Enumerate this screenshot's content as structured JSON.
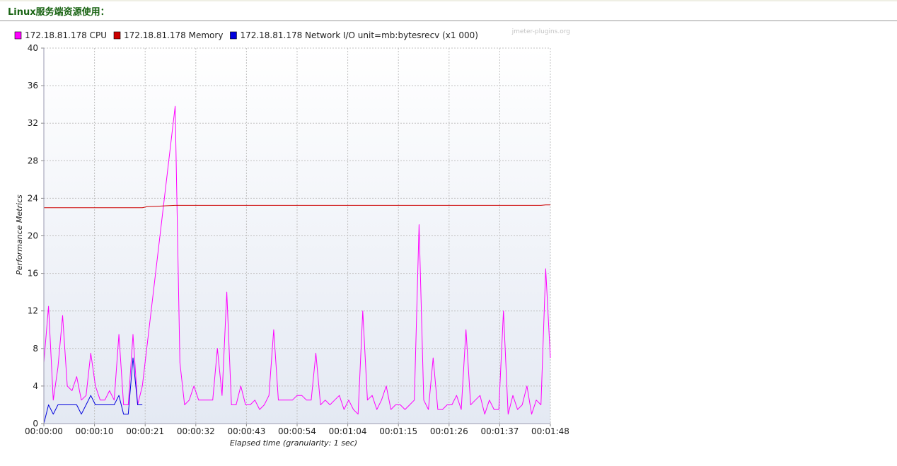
{
  "header": {
    "title": "Linux服务端资源使用："
  },
  "chart_data": {
    "type": "line",
    "watermark": "jmeter-plugins.org",
    "xlabel": "Elapsed time (granularity: 1 sec)",
    "ylabel": "Performance Metrics",
    "ylim": [
      0,
      40
    ],
    "xlim": [
      0,
      108
    ],
    "y_ticks": [
      "0",
      "4",
      "8",
      "12",
      "16",
      "20",
      "24",
      "28",
      "32",
      "36",
      "40"
    ],
    "x_ticks": [
      {
        "t": 0,
        "label": "00:00:00"
      },
      {
        "t": 10.8,
        "label": "00:00:10"
      },
      {
        "t": 21.6,
        "label": "00:00:21"
      },
      {
        "t": 32.4,
        "label": "00:00:32"
      },
      {
        "t": 43.2,
        "label": "00:00:43"
      },
      {
        "t": 54,
        "label": "00:00:54"
      },
      {
        "t": 64.8,
        "label": "00:01:04"
      },
      {
        "t": 75.6,
        "label": "00:01:15"
      },
      {
        "t": 86.4,
        "label": "00:01:26"
      },
      {
        "t": 97.2,
        "label": "00:01:37"
      },
      {
        "t": 108,
        "label": "00:01:48"
      }
    ],
    "grid": true,
    "legend_position": "top",
    "series": [
      {
        "name": "172.18.81.178 CPU",
        "color": "#ff00ff",
        "points": [
          [
            0,
            6.5
          ],
          [
            1,
            12.5
          ],
          [
            2,
            2.5
          ],
          [
            3,
            6
          ],
          [
            4,
            11.5
          ],
          [
            5,
            4
          ],
          [
            6,
            3.5
          ],
          [
            7,
            5
          ],
          [
            8,
            2.5
          ],
          [
            9,
            3
          ],
          [
            10,
            7.5
          ],
          [
            11,
            4
          ],
          [
            12,
            2.5
          ],
          [
            13,
            2.5
          ],
          [
            14,
            3.5
          ],
          [
            15,
            2.5
          ],
          [
            16,
            9.5
          ],
          [
            17,
            2
          ],
          [
            18,
            2
          ],
          [
            19,
            9.5
          ],
          [
            20,
            2
          ],
          [
            21,
            4
          ],
          [
            28,
            33.8
          ],
          [
            29,
            6.5
          ],
          [
            30,
            2
          ],
          [
            31,
            2.5
          ],
          [
            32,
            4
          ],
          [
            33,
            2.5
          ],
          [
            34,
            2.5
          ],
          [
            35,
            2.5
          ],
          [
            36,
            2.5
          ],
          [
            37,
            8
          ],
          [
            38,
            3
          ],
          [
            39,
            14
          ],
          [
            40,
            2
          ],
          [
            41,
            2
          ],
          [
            42,
            4
          ],
          [
            43,
            2
          ],
          [
            44,
            2
          ],
          [
            45,
            2.5
          ],
          [
            46,
            1.5
          ],
          [
            47,
            2
          ],
          [
            48,
            3
          ],
          [
            49,
            10
          ],
          [
            50,
            2.5
          ],
          [
            51,
            2.5
          ],
          [
            52,
            2.5
          ],
          [
            53,
            2.5
          ],
          [
            54,
            3
          ],
          [
            55,
            3
          ],
          [
            56,
            2.5
          ],
          [
            57,
            2.5
          ],
          [
            58,
            7.5
          ],
          [
            59,
            2
          ],
          [
            60,
            2.5
          ],
          [
            61,
            2
          ],
          [
            62,
            2.5
          ],
          [
            63,
            3
          ],
          [
            64,
            1.5
          ],
          [
            65,
            2.5
          ],
          [
            66,
            1.5
          ],
          [
            67,
            1
          ],
          [
            68,
            12
          ],
          [
            69,
            2.5
          ],
          [
            70,
            3
          ],
          [
            71,
            1.5
          ],
          [
            72,
            2.5
          ],
          [
            73,
            4
          ],
          [
            74,
            1.5
          ],
          [
            75,
            2
          ],
          [
            76,
            2
          ],
          [
            77,
            1.5
          ],
          [
            78,
            2
          ],
          [
            79,
            2.5
          ],
          [
            80,
            21.2
          ],
          [
            81,
            2.5
          ],
          [
            82,
            1.5
          ],
          [
            83,
            7
          ],
          [
            84,
            1.5
          ],
          [
            85,
            1.5
          ],
          [
            86,
            2
          ],
          [
            87,
            2
          ],
          [
            88,
            3
          ],
          [
            89,
            1.5
          ],
          [
            90,
            10
          ],
          [
            91,
            2
          ],
          [
            92,
            2.5
          ],
          [
            93,
            3
          ],
          [
            94,
            1
          ],
          [
            95,
            2.5
          ],
          [
            96,
            1.5
          ],
          [
            97,
            1.5
          ],
          [
            98,
            12
          ],
          [
            99,
            1
          ],
          [
            100,
            3
          ],
          [
            101,
            1.5
          ],
          [
            102,
            2
          ],
          [
            103,
            4
          ],
          [
            104,
            1
          ],
          [
            105,
            2.5
          ],
          [
            106,
            2
          ],
          [
            107,
            16.5
          ],
          [
            108,
            7
          ]
        ]
      },
      {
        "name": "172.18.81.178 Memory",
        "color": "#cc0000",
        "points": [
          [
            0,
            23
          ],
          [
            10,
            23
          ],
          [
            20,
            23
          ],
          [
            21,
            23
          ],
          [
            22,
            23.1
          ],
          [
            24,
            23.15
          ],
          [
            26,
            23.2
          ],
          [
            28,
            23.25
          ],
          [
            40,
            23.25
          ],
          [
            60,
            23.25
          ],
          [
            80,
            23.25
          ],
          [
            100,
            23.25
          ],
          [
            106,
            23.25
          ],
          [
            107,
            23.3
          ],
          [
            108,
            23.3
          ]
        ]
      },
      {
        "name": "172.18.81.178 Network I/O unit=mb:bytesrecv (x1 000)",
        "color": "#0000dd",
        "points": [
          [
            0,
            0
          ],
          [
            1,
            2
          ],
          [
            2,
            1
          ],
          [
            3,
            2
          ],
          [
            4,
            2
          ],
          [
            5,
            2
          ],
          [
            6,
            2
          ],
          [
            7,
            2
          ],
          [
            8,
            1
          ],
          [
            9,
            2
          ],
          [
            10,
            3
          ],
          [
            11,
            2
          ],
          [
            12,
            2
          ],
          [
            13,
            2
          ],
          [
            14,
            2
          ],
          [
            15,
            2
          ],
          [
            16,
            3
          ],
          [
            17,
            1
          ],
          [
            18,
            1
          ],
          [
            19,
            7
          ],
          [
            20,
            2
          ],
          [
            21,
            2
          ]
        ]
      }
    ]
  }
}
